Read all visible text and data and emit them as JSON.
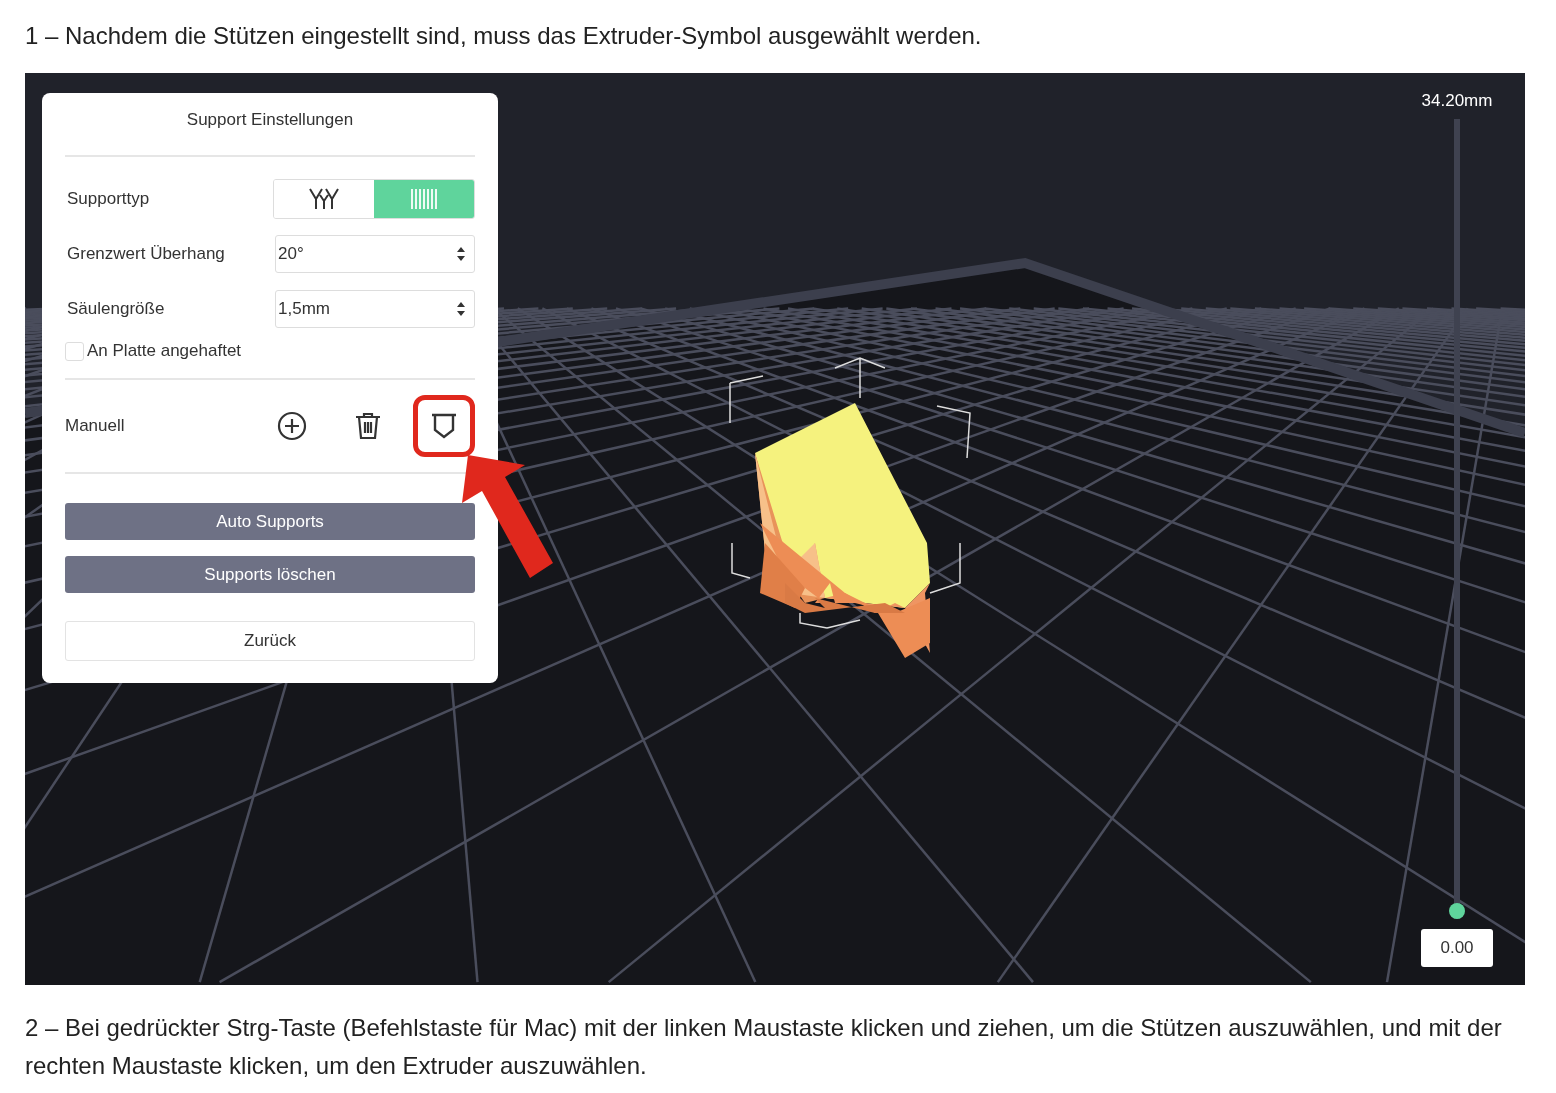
{
  "captions": [
    {
      "text": "1 – Nachdem die Stützen eingestellt sind, muss das Extruder-Symbol ausgewählt werden."
    },
    {
      "text": "2 – Bei gedrückter Strg-Taste (Befehlstaste für Mac) mit der linken Maustaste klicken und ziehen, um die Stützen auszuwählen, und mit der rechten Maustaste klicken, um den Extruder auszuwählen."
    }
  ],
  "viewer": {
    "panel": {
      "title": "Support Einstellungen",
      "support_type": {
        "label": "Supporttyp",
        "options": [
          {
            "kind": "tree",
            "selected": false
          },
          {
            "kind": "pillar",
            "selected": true
          }
        ]
      },
      "fields": [
        {
          "label": "Grenzwert Überhang",
          "value": "20°"
        },
        {
          "label": "Säulengröße",
          "value": "1,5mm"
        }
      ],
      "checkbox": {
        "label": "An Platte angehaftet",
        "checked": false
      },
      "manual": {
        "label": "Manuell",
        "tools": [
          {
            "kind": "add",
            "highlighted": false
          },
          {
            "kind": "delete",
            "highlighted": false
          },
          {
            "kind": "extruder",
            "highlighted": true
          }
        ]
      },
      "buttons": [
        {
          "label": "Auto Supports",
          "kind": "primary"
        },
        {
          "label": "Supports löschen",
          "kind": "primary"
        },
        {
          "label": "Zurück",
          "kind": "secondary"
        }
      ]
    },
    "layer_slider": {
      "max_label": "34.20mm",
      "level": 0,
      "value": "0.00"
    }
  }
}
